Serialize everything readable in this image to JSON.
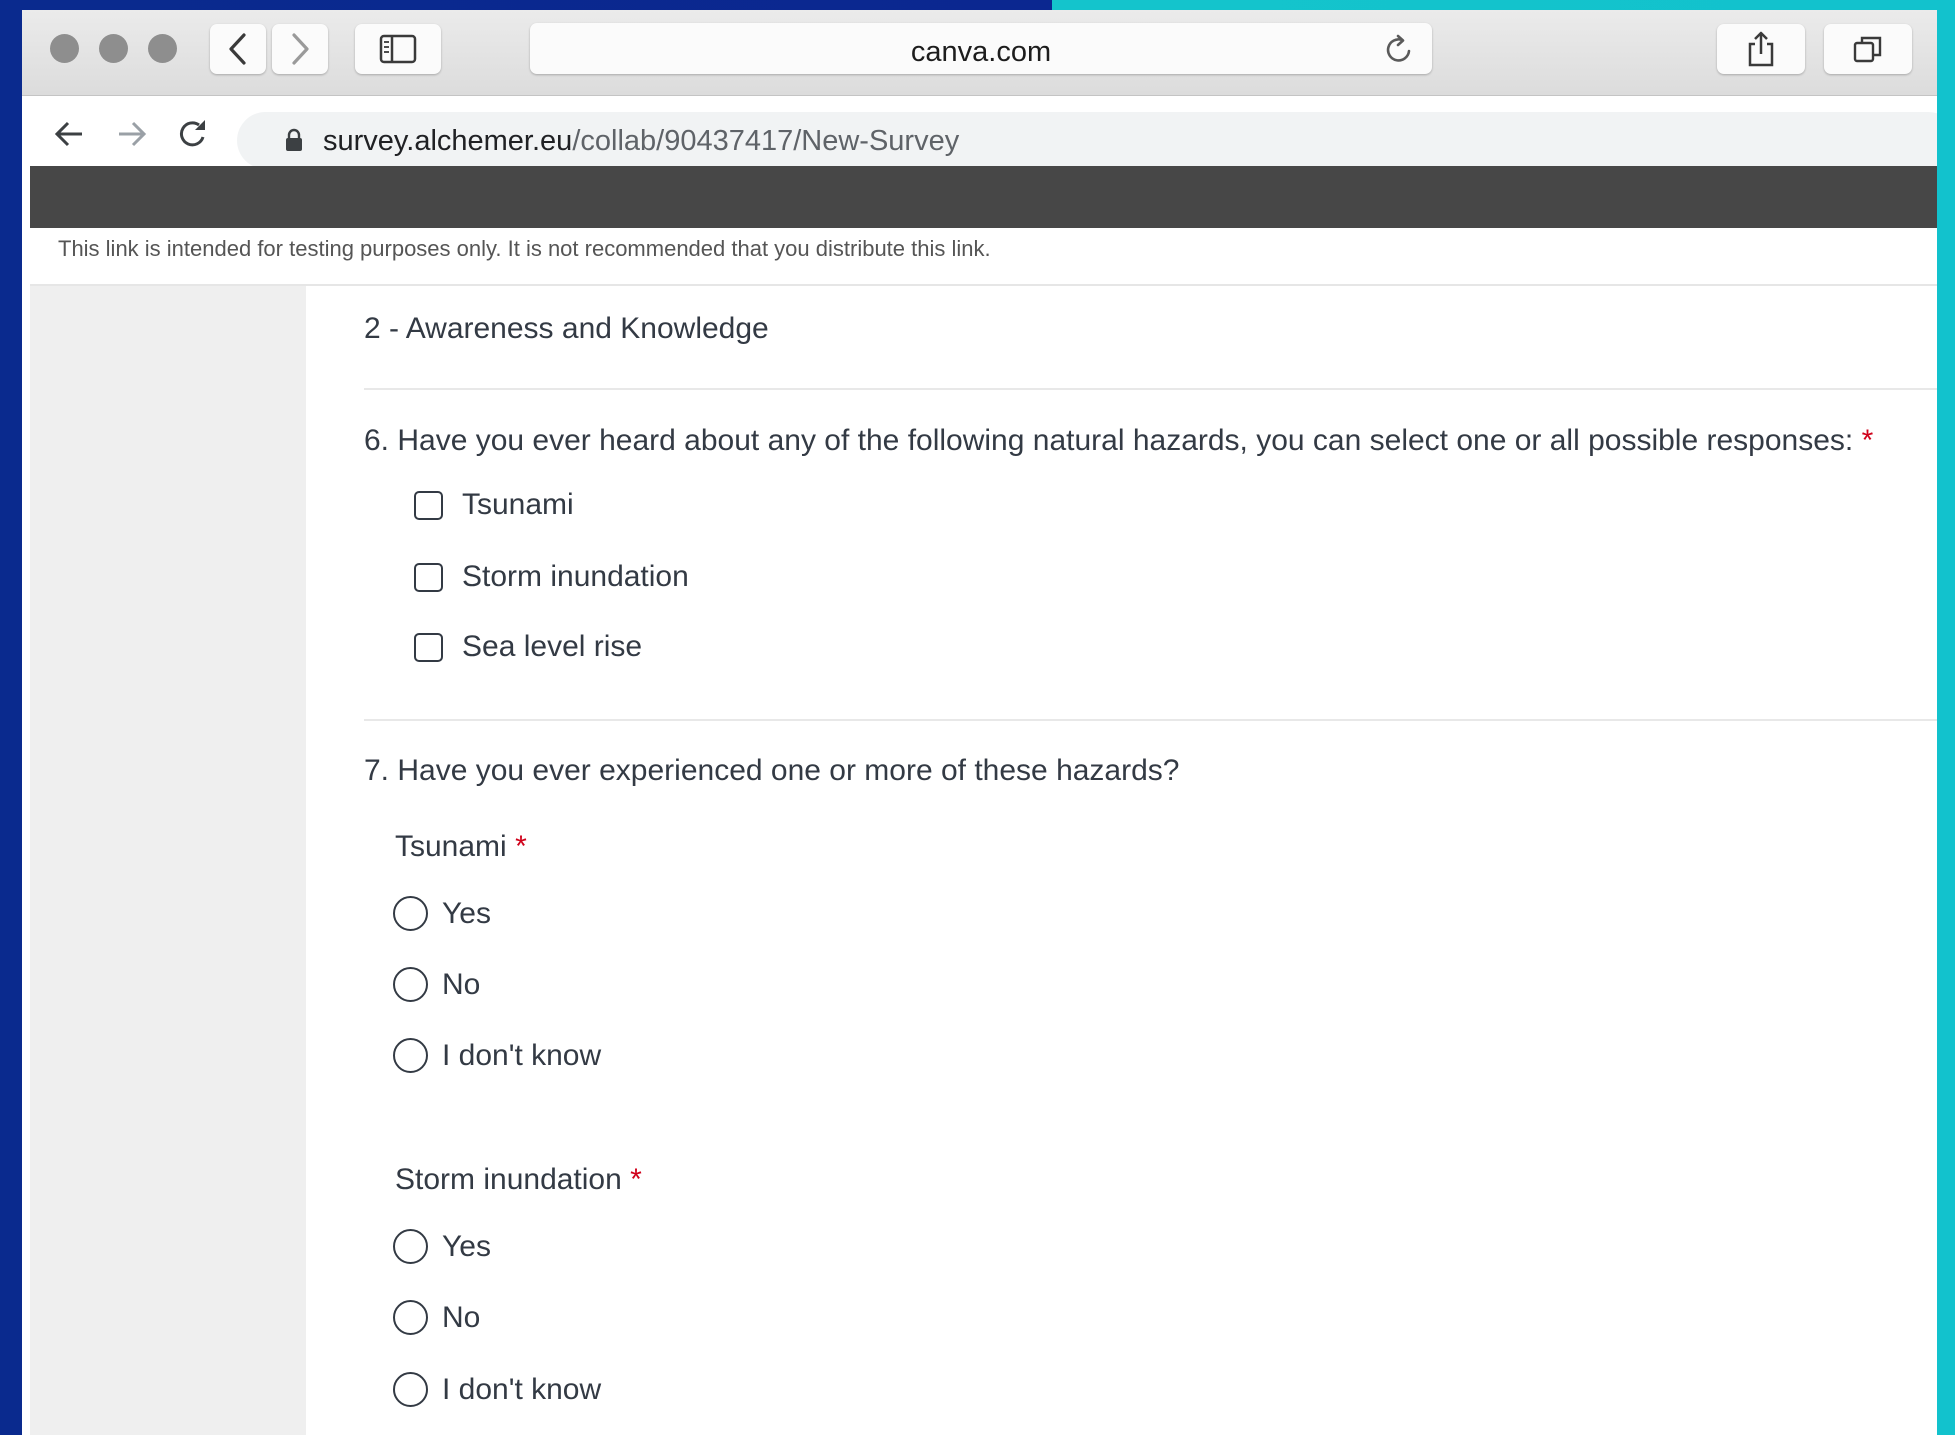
{
  "browser": {
    "title_bar_url": "canva.com",
    "url_host": "survey.alchemer.eu",
    "url_path": "/collab/90437417/New-Survey"
  },
  "page": {
    "notice": "This link is intended for testing purposes only. It is not recommended that you distribute this link.",
    "section_title": "2 - Awareness and Knowledge"
  },
  "q6": {
    "text": "6. Have you ever heard about any of the following natural hazards, you can select one or all possible responses:",
    "required_mark": "*",
    "options": [
      "Tsunami",
      "Storm inundation",
      "Sea level rise"
    ]
  },
  "q7": {
    "text": "7. Have you ever experienced one or more of these hazards?",
    "groups": [
      {
        "label": "Tsunami",
        "required_mark": "*",
        "options": [
          "Yes",
          "No",
          "I don't know"
        ]
      },
      {
        "label": "Storm inundation",
        "required_mark": "*",
        "options": [
          "Yes",
          "No",
          "I don't know"
        ]
      }
    ]
  },
  "colors": {
    "text": "#333a44",
    "required": "#d0021b",
    "header_bar": "#474747",
    "side_panel": "#efefef"
  },
  "icons": {
    "traffic_lights": [
      "close-dot-icon",
      "minimize-dot-icon",
      "zoom-dot-icon"
    ],
    "title_bar": [
      "chevron-left-icon",
      "chevron-right-icon",
      "sidebar-icon",
      "reload-icon",
      "share-icon",
      "tabs-icon"
    ],
    "toolbar": [
      "back-arrow-icon",
      "forward-arrow-icon",
      "refresh-icon",
      "lock-icon"
    ]
  }
}
